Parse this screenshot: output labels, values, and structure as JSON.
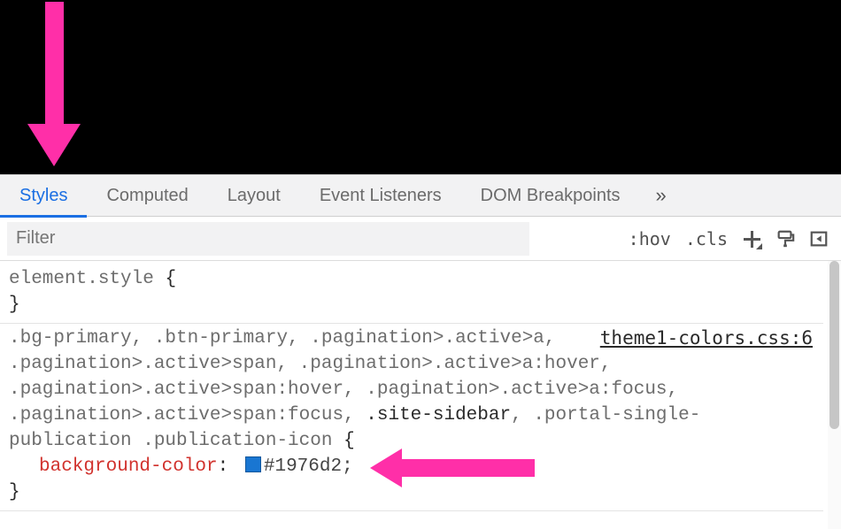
{
  "tabs": {
    "styles": "Styles",
    "computed": "Computed",
    "layout": "Layout",
    "event_listeners": "Event Listeners",
    "dom_breakpoints": "DOM Breakpoints",
    "overflow": "»"
  },
  "toolbar": {
    "filter_placeholder": "Filter",
    "hov": ":hov",
    "cls": ".cls"
  },
  "rules": {
    "element_style": {
      "selector": "element.style",
      "open": "{",
      "close": "}"
    },
    "rule1": {
      "selectors_pre": ".bg-primary, .btn-primary, .pagination>.active>a, .pagination>.active>span, .pagination>.active>a:hover, .pagination>.active>span:hover, .pagination>.active>a:focus, .pagination>.active>span:focus, ",
      "selectors_emph": ".site-sidebar",
      "selectors_post1": ", ",
      "selectors_post2": ".portal-single-publication .publication-icon",
      "open": " {",
      "close": "}",
      "source": "theme1-colors.css:6",
      "decl": {
        "name": "background-color",
        "colon": ":",
        "value": "#1976d2",
        "semi": ";",
        "swatch_color": "#1976d2"
      }
    }
  }
}
